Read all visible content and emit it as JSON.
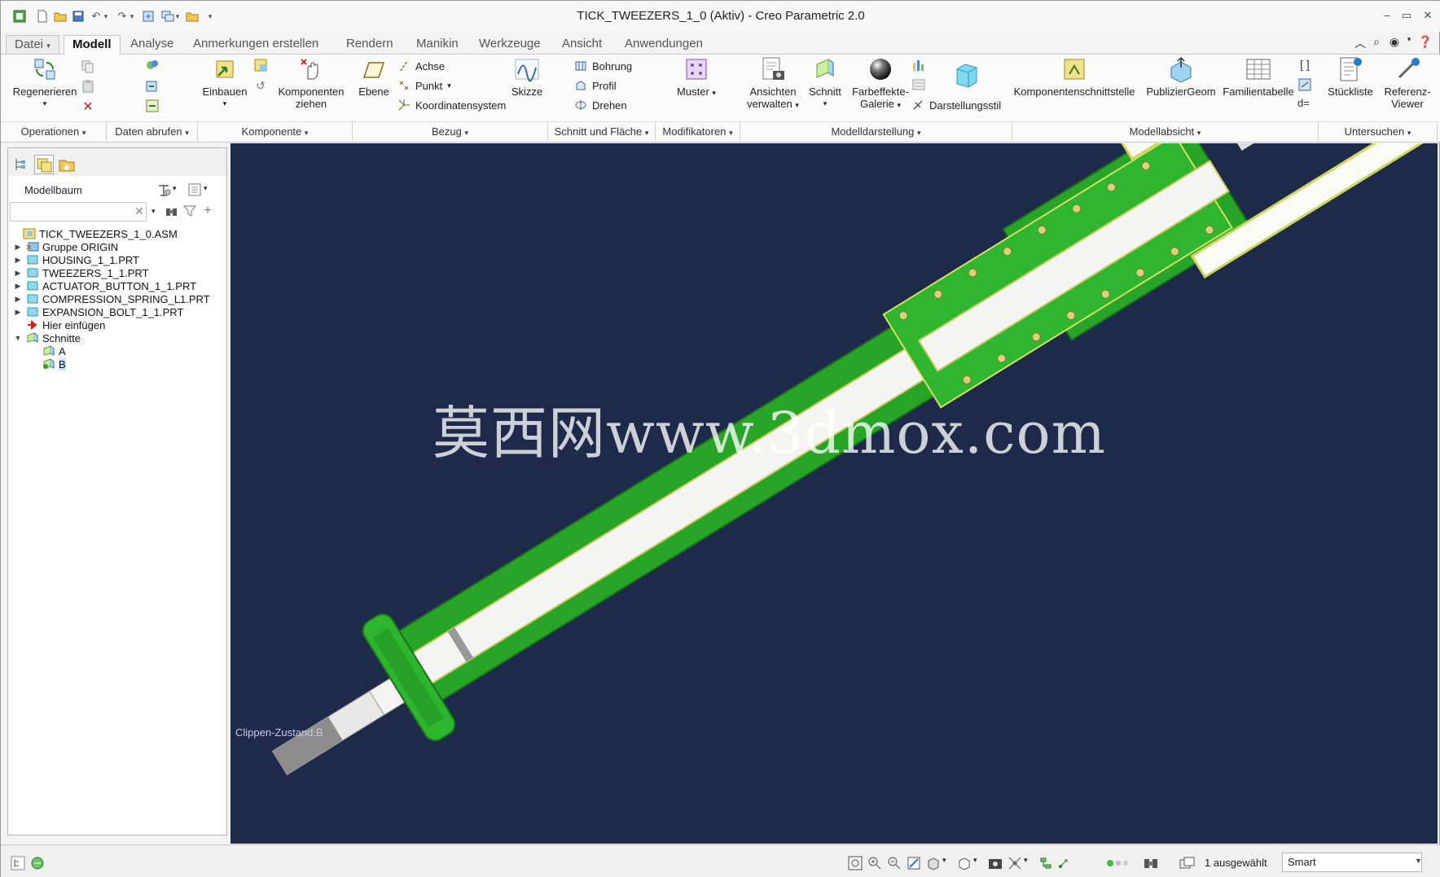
{
  "window": {
    "title": "TICK_TWEEZERS_1_0 (Aktiv) - Creo Parametric 2.0"
  },
  "ribbon_tabs": [
    "Datei",
    "Modell",
    "Analyse",
    "Anmerkungen erstellen",
    "Rendern",
    "Manikin",
    "Werkzeuge",
    "Ansicht",
    "Anwendungen"
  ],
  "ribbon": {
    "regenerieren": "Regenerieren",
    "einbauen": "Einbauen",
    "komponenten_ziehen_1": "Komponenten",
    "komponenten_ziehen_2": "ziehen",
    "ebene": "Ebene",
    "achse": "Achse",
    "punkt": "Punkt",
    "koordinatensystem": "Koordinatensystem",
    "skizze": "Skizze",
    "bohrung": "Bohrung",
    "profil": "Profil",
    "drehen": "Drehen",
    "muster": "Muster",
    "ansichten_1": "Ansichten",
    "ansichten_2": "verwalten",
    "schnitt": "Schnitt",
    "farbeffekte_1": "Farbeffekte-",
    "farbeffekte_2": "Galerie",
    "darstellungsstil": "Darstellungsstil",
    "komponentenschnittstelle": "Komponentenschnittstelle",
    "publiziergeom": "PublizierGeom",
    "familientabelle": "Familientabelle",
    "stueckliste": "Stückliste",
    "referenz_1": "Referenz-",
    "referenz_2": "Viewer"
  },
  "groups": {
    "operationen": "Operationen",
    "daten_abrufen": "Daten abrufen",
    "komponente": "Komponente",
    "bezug": "Bezug",
    "schnitt_flaeche": "Schnitt und Fläche",
    "modifikatoren": "Modifikatoren",
    "modelldarstellung": "Modelldarstellung",
    "modellabsicht": "Modellabsicht",
    "untersuchen": "Untersuchen"
  },
  "model_tree": {
    "title": "Modellbaum",
    "search_value": "",
    "items": [
      {
        "label": "TICK_TWEEZERS_1_0.ASM"
      },
      {
        "label": "Gruppe ORIGIN"
      },
      {
        "label": "HOUSING_1_1.PRT"
      },
      {
        "label": "TWEEZERS_1_1.PRT"
      },
      {
        "label": "ACTUATOR_BUTTON_1_1.PRT"
      },
      {
        "label": "COMPRESSION_SPRING_L1.PRT"
      },
      {
        "label": "EXPANSION_BOLT_1_1.PRT"
      },
      {
        "label": "Hier einfügen"
      },
      {
        "label": "Schnitte"
      },
      {
        "label": "A"
      },
      {
        "label": "B"
      }
    ]
  },
  "viewport": {
    "clip_state": "Clippen-Zustand:B",
    "watermark": "莫西网www.3dmox.com",
    "background_color": "#1d2a4a",
    "part_color": "#2eb52e"
  },
  "statusbar": {
    "selection": "1 ausgewählt",
    "filter": "Smart"
  }
}
